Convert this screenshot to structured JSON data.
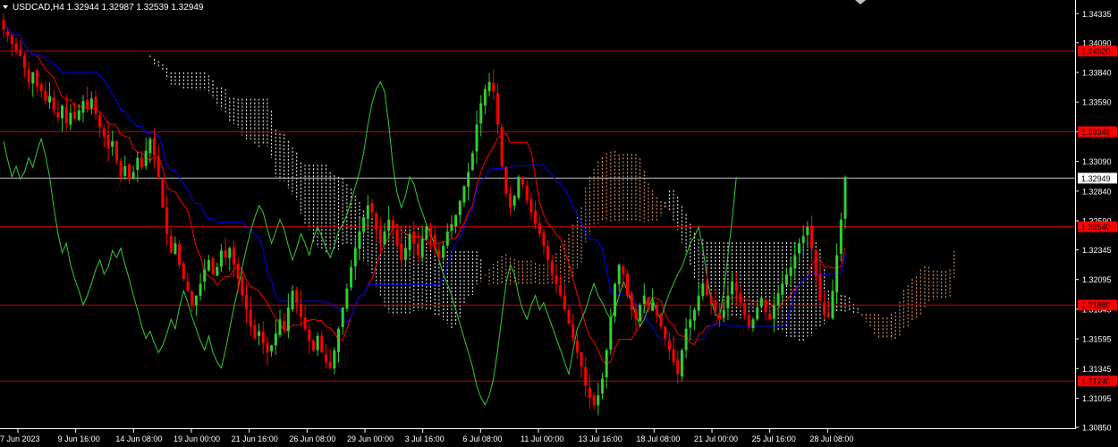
{
  "header": {
    "symbol_line": "USDCAD,H4  1.32944 1.32987 1.32539 1.32949",
    "dropdown_icon": "triangle-down-icon"
  },
  "colors": {
    "background": "#000000",
    "bull": "#32CD32",
    "bear": "#FF0000",
    "tenkan": "#FF0000",
    "kijun": "#0000FF",
    "chikou": "#32CD32",
    "cloud_a": "#FFFFFF",
    "cloud_b": "#F4A460",
    "level_line": "#C80000",
    "price_line": "#C0C0C0",
    "axis_text": "#FFFFFF",
    "price_tag": "#FF0000"
  },
  "chart_data": {
    "type": "candlestick",
    "symbol": "USDCAD",
    "timeframe": "H4",
    "current_price": 1.32949,
    "ylim": [
      1.3085,
      1.3445
    ],
    "price_ticks": [
      "1.34335",
      "1.34090",
      "1.33840",
      "1.33590",
      "1.33340",
      "1.33090",
      "1.32840",
      "1.32590",
      "1.32345",
      "1.32095",
      "1.31845",
      "1.31595",
      "1.31345",
      "1.31095",
      "1.30850"
    ],
    "horizontal_levels": [
      {
        "label": "1.34020",
        "price": 1.3402
      },
      {
        "label": "1.33340",
        "price": 1.3334
      },
      {
        "label": "1.32540",
        "price": 1.3254
      },
      {
        "label": "1.31880",
        "price": 1.3188
      },
      {
        "label": "1.31240",
        "price": 1.3124
      }
    ],
    "price_line_label": "1.32949",
    "time_labels": [
      "7 Jun 2023",
      "9 Jun 16:00",
      "14 Jun 08:00",
      "19 Jun 00:00",
      "21 Jun 16:00",
      "26 Jun 08:00",
      "29 Jun 00:00",
      "3 Jul 16:00",
      "6 Jul 08:00",
      "11 Jul 00:00",
      "13 Jul 16:00",
      "18 Jul 08:00",
      "21 Jul 00:00",
      "25 Jul 16:00",
      "28 Jul 08:00"
    ],
    "closes": [
      1.342,
      1.3415,
      1.3408,
      1.3402,
      1.3398,
      1.3388,
      1.3376,
      1.3384,
      1.3372,
      1.3368,
      1.336,
      1.3364,
      1.3352,
      1.3346,
      1.3356,
      1.3341,
      1.335,
      1.3345,
      1.3352,
      1.336,
      1.3354,
      1.3362,
      1.3349,
      1.3338,
      1.333,
      1.332,
      1.3326,
      1.331,
      1.3296,
      1.3305,
      1.3294,
      1.33,
      1.3312,
      1.3304,
      1.3318,
      1.3328,
      1.3314,
      1.3296,
      1.327,
      1.3248,
      1.3232,
      1.324,
      1.3222,
      1.321,
      1.32,
      1.3188,
      1.3196,
      1.3206,
      1.3218,
      1.3226,
      1.3214,
      1.322,
      1.3234,
      1.3228,
      1.3236,
      1.3222,
      1.321,
      1.3196,
      1.3184,
      1.317,
      1.316,
      1.3166,
      1.3156,
      1.3148,
      1.3154,
      1.3164,
      1.3176,
      1.3168,
      1.3186,
      1.32,
      1.319,
      1.3178,
      1.3168,
      1.3158,
      1.315,
      1.3162,
      1.3148,
      1.314,
      1.3135,
      1.315,
      1.3168,
      1.3186,
      1.3202,
      1.322,
      1.3236,
      1.325,
      1.3262,
      1.3272,
      1.3266,
      1.3252,
      1.324,
      1.325,
      1.326,
      1.3252,
      1.3238,
      1.3226,
      1.3236,
      1.3248,
      1.324,
      1.323,
      1.3244,
      1.3254,
      1.3246,
      1.3236,
      1.3228,
      1.3238,
      1.325,
      1.3256,
      1.3264,
      1.3276,
      1.3288,
      1.33,
      1.3316,
      1.334,
      1.3358,
      1.337,
      1.3376,
      1.3368,
      1.334,
      1.3305,
      1.3282,
      1.327,
      1.328,
      1.3296,
      1.329,
      1.3276,
      1.3266,
      1.3256,
      1.3248,
      1.3238,
      1.3226,
      1.3214,
      1.3206,
      1.3196,
      1.3184,
      1.3172,
      1.316,
      1.3148,
      1.3136,
      1.312,
      1.311,
      1.3104,
      1.3112,
      1.3126,
      1.315,
      1.3178,
      1.3206,
      1.3222,
      1.3214,
      1.3196,
      1.3184,
      1.3176,
      1.3188,
      1.3196,
      1.3184,
      1.319,
      1.318,
      1.317,
      1.316,
      1.315,
      1.314,
      1.313,
      1.315,
      1.3168,
      1.3176,
      1.3184,
      1.3196,
      1.3206,
      1.3196,
      1.319,
      1.3182,
      1.3176,
      1.3184,
      1.3196,
      1.3208,
      1.32,
      1.319,
      1.318,
      1.317,
      1.3176,
      1.3186,
      1.3194,
      1.3182,
      1.3176,
      1.3188,
      1.3198,
      1.3206,
      1.3214,
      1.322,
      1.323,
      1.324,
      1.3246,
      1.3254,
      1.3236,
      1.3212,
      1.3192,
      1.318,
      1.3178,
      1.32,
      1.323,
      1.326,
      1.3296
    ]
  }
}
